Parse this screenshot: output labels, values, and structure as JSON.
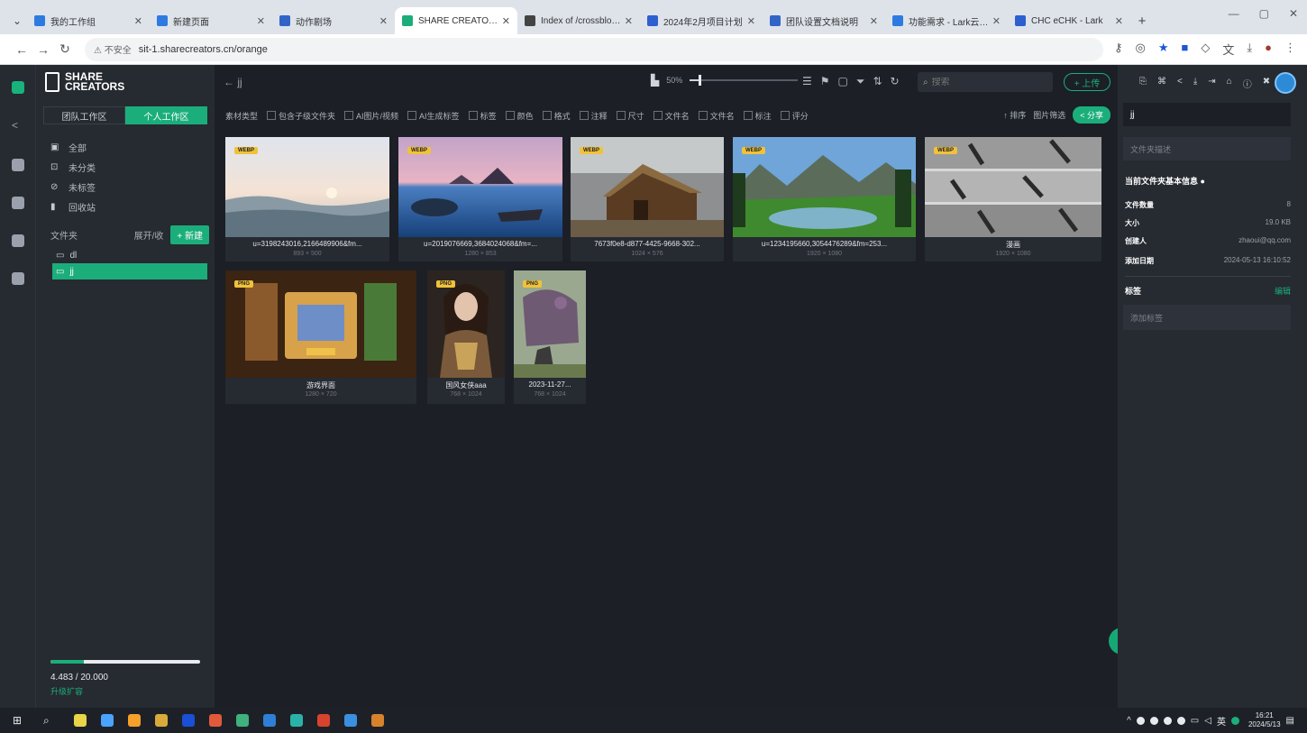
{
  "browser": {
    "tabs": [
      {
        "title": "我的工作组",
        "color": "#2d7be0",
        "active": false
      },
      {
        "title": "新建页面",
        "color": "#2d7be0",
        "active": false
      },
      {
        "title": "动作剧场",
        "color": "#3264c8",
        "active": false
      },
      {
        "title": "SHARE CREATORS",
        "color": "#1bae7b",
        "active": true
      },
      {
        "title": "Index of /crossbloom",
        "color": "#444444",
        "active": false
      },
      {
        "title": "2024年2月项目计划",
        "color": "#2d5fd0",
        "active": false
      },
      {
        "title": "团队设置文档说明",
        "color": "#3264c8",
        "active": false
      },
      {
        "title": "功能需求 - Lark云文档",
        "color": "#2d7be0",
        "active": false
      },
      {
        "title": "CHC eCHK - Lark",
        "color": "#2d5fd0",
        "active": false
      }
    ],
    "url_warning": "不安全",
    "url": "sit-1.sharecreators.cn/orange"
  },
  "sidebar": {
    "logo_line1": "SHARE",
    "logo_line2": "CREATORS",
    "workspace_tabs": [
      "团队工作区",
      "个人工作区"
    ],
    "quick_links": [
      {
        "icon": "▣",
        "label": "全部"
      },
      {
        "icon": "⊡",
        "label": "未分类"
      },
      {
        "icon": "⊘",
        "label": "未标签"
      },
      {
        "icon": "▮",
        "label": "回收站"
      }
    ],
    "folders_label": "文件夹",
    "folders_action": "展开/收",
    "new_button": "+ 新建",
    "folders": [
      {
        "label": "dl",
        "selected": false
      },
      {
        "label": "jj",
        "selected": true
      }
    ],
    "storage_used": "4.483 / 20.000",
    "storage_link": "升级扩容",
    "storage_fraction": 0.22
  },
  "toolbar": {
    "back": "← jj",
    "zoom": "50%",
    "zoom_fraction": 0.08,
    "search_placeholder": "搜索",
    "upload_label": "+ 上传"
  },
  "filters": {
    "items": [
      "素材类型",
      "包含子级文件夹",
      "AI图片/视频",
      "AI生成标签",
      "标签",
      "颜色",
      "格式",
      "注释",
      "尺寸",
      "文件名",
      "文件名",
      "标注",
      "评分"
    ],
    "sort_label": "↑ 排序",
    "sub_label": "图片筛选",
    "share_button": "< 分享"
  },
  "assets": [
    {
      "name": "u=3198243016,2166489906&fm...",
      "dims": "893 × 500",
      "badge": "WEBP"
    },
    {
      "name": "u=2019076669,3684024068&fm=...",
      "dims": "1280 × 853",
      "badge": "WEBP"
    },
    {
      "name": "7673f0e8-d877-4425-9668-302...",
      "dims": "1024 × 576",
      "badge": "WEBP"
    },
    {
      "name": "u=1234195660,3054476289&fm=253...",
      "dims": "1920 × 1080",
      "badge": "WEBP"
    },
    {
      "name": "漫画",
      "dims": "1920 × 1080",
      "badge": "WEBP"
    },
    {
      "name": "游戏界面",
      "dims": "1280 × 720",
      "badge": "PNG"
    },
    {
      "name": "国风女侠aaa",
      "dims": "768 × 1024",
      "badge": "PNG"
    },
    {
      "name": "2023-11-27...",
      "dims": "768 × 1024",
      "badge": "PNG"
    }
  ],
  "properties": {
    "name": "jj",
    "note_placeholder": "文件夹描述",
    "section_title": "当前文件夹基本信息",
    "rows": [
      {
        "key": "文件数量",
        "value": "8"
      },
      {
        "key": "大小",
        "value": "19.0 KB"
      },
      {
        "key": "创建人",
        "value": "zhaoui@qq.com"
      },
      {
        "key": "添加日期",
        "value": "2024-05-13 16:10:52"
      }
    ],
    "tags_label": "标签",
    "tags_action": "编辑",
    "tag_placeholder": "添加标签"
  },
  "taskbar": {
    "apps": [
      "#e8d548",
      "#4aa3ff",
      "#f4a02a",
      "#d9a93a",
      "#1a4fd6",
      "#e25a3b",
      "#3fb07e",
      "#2f7fd8",
      "#2bb2a8",
      "#d8432e",
      "#3b8fe0",
      "#d9822b"
    ],
    "time": "16:21",
    "date": "2024/5/13"
  },
  "colors": {
    "accent": "#1bae7b",
    "app_bg": "#1c1f26",
    "panel_bg": "#262a31",
    "badge": "#f0c23a"
  }
}
